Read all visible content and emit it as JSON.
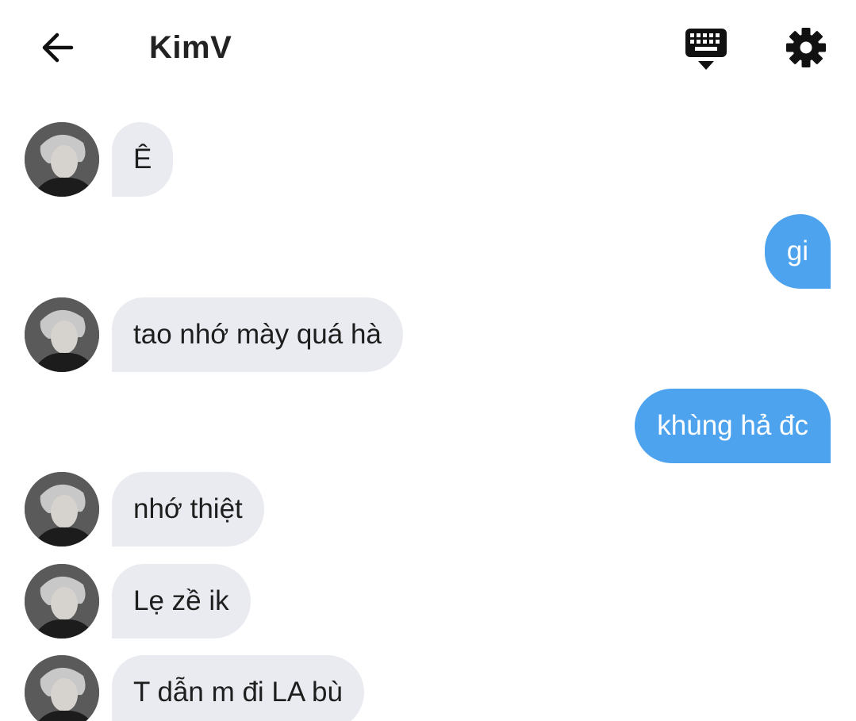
{
  "header": {
    "title": "KimV"
  },
  "icons": {
    "back": "arrow-left-icon",
    "keyboard": "keyboard-hide-icon",
    "settings": "gear-icon"
  },
  "colors": {
    "incoming_bubble": "#e9ebf0",
    "outgoing_bubble": "#4da3ee",
    "title_text": "#222222"
  },
  "messages": [
    {
      "direction": "incoming",
      "text": "Ê"
    },
    {
      "direction": "outgoing",
      "text": "gi"
    },
    {
      "direction": "incoming",
      "text": "tao nhớ mày quá hà"
    },
    {
      "direction": "outgoing",
      "text": "khùng hả đc"
    },
    {
      "direction": "incoming",
      "text": "nhớ thiệt"
    },
    {
      "direction": "incoming",
      "text": "Lẹ zề ik"
    },
    {
      "direction": "incoming",
      "text": "T dẫn m đi LA bù"
    }
  ]
}
